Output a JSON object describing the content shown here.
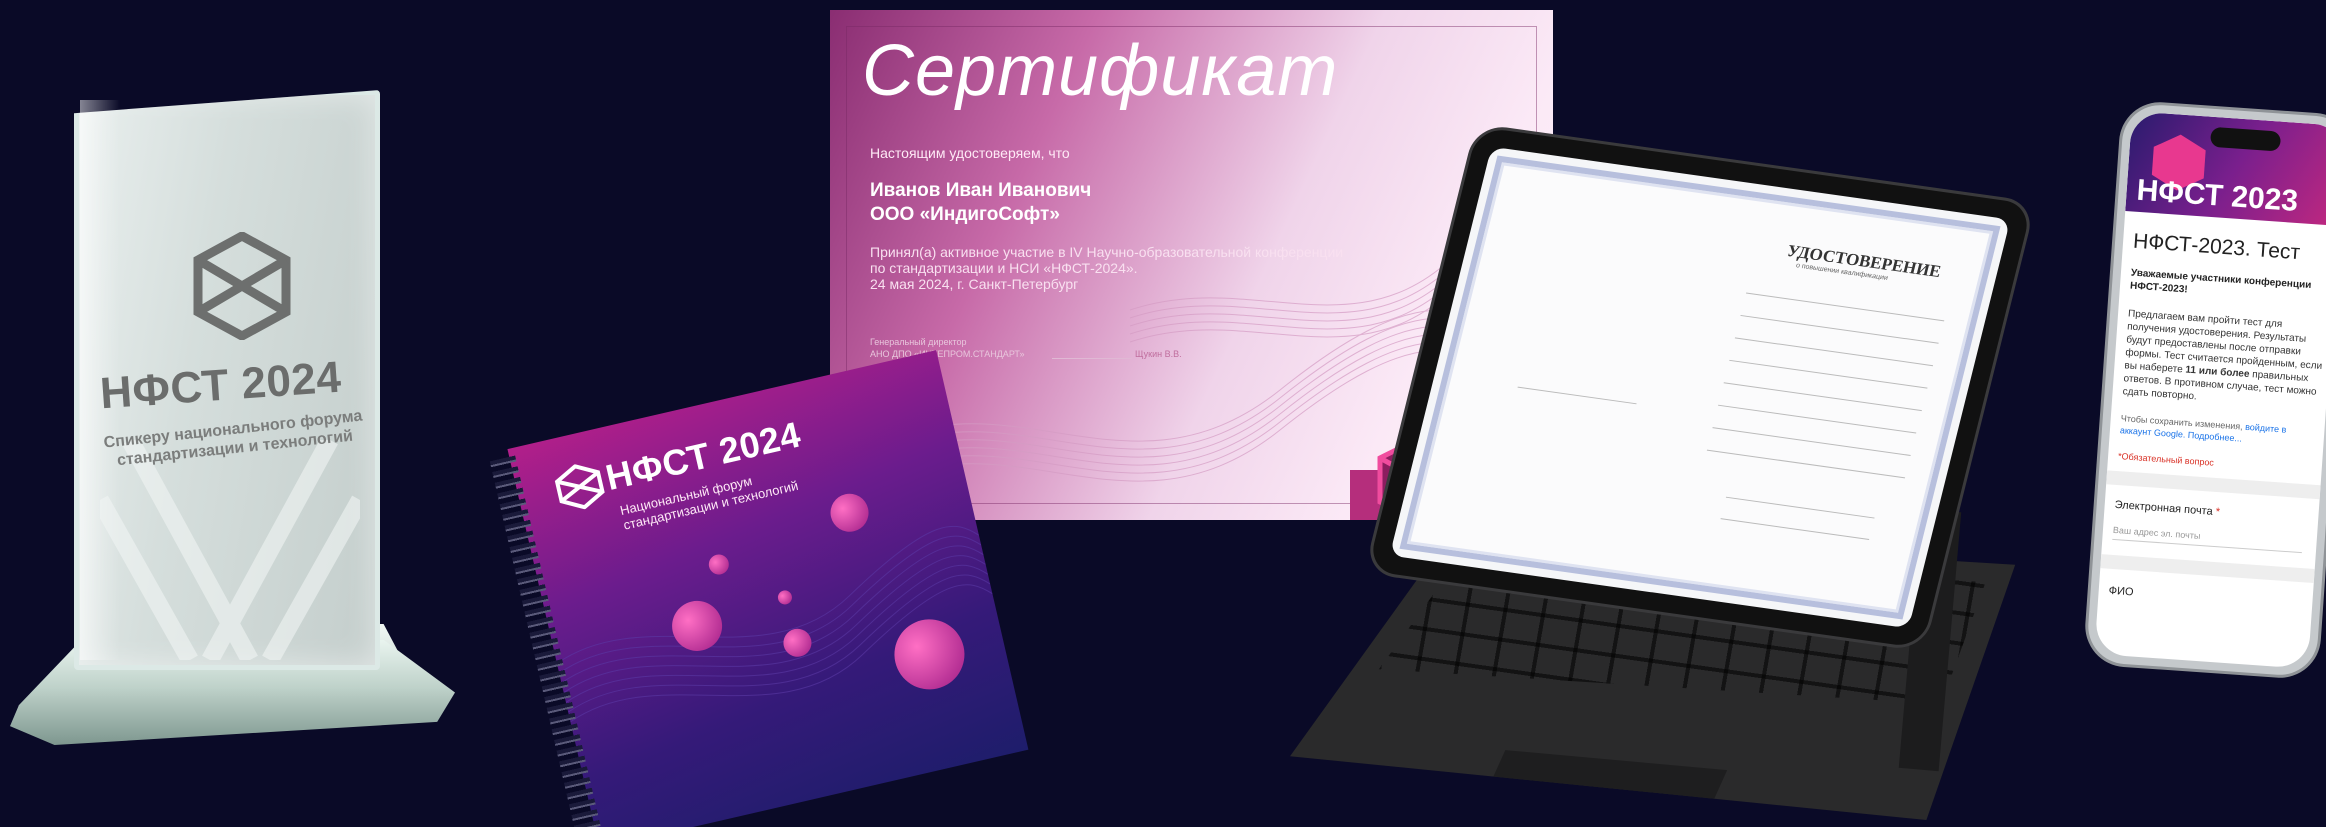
{
  "trophy": {
    "title": "НФСТ 2024",
    "subtitle_line1": "Спикеру национального форума",
    "subtitle_line2": "стандартизации и технологий"
  },
  "certificate": {
    "title": "Сертификат",
    "intro": "Настоящим удостоверяем, что",
    "name": "Иванов Иван Иванович",
    "organization": "ООО «ИндигоСофт»",
    "body_line1": "Принял(а) активное участие в IV Научно-образовательной конференции",
    "body_line2": "по стандартизации и НСИ «НФСТ-2024».",
    "body_line3": "24 мая 2024, г. Санкт-Петербург",
    "signer_role": "Генеральный директор",
    "signer_org": "АНО ДПО «ИНТЕПРОМ.СТАНДАРТ»",
    "signer_name": "Щукин В.В."
  },
  "notebook": {
    "title": "НФСТ 2024",
    "subtitle_line1": "Национальный форум",
    "subtitle_line2": "стандартизации и технологий"
  },
  "tablet": {
    "doc_title": "УДОСТОВЕРЕНИЕ",
    "doc_subtitle": "о повышении квалификации"
  },
  "phone": {
    "banner_title": "НФСТ 2023",
    "form_title": "НФСТ-2023. Тест",
    "greeting": "Уважаемые участники конференции НФСТ-2023!",
    "text_before": "Предлагаем вам пройти тест для получения удостоверения. Результаты будут предоставлены после отправки формы. Тест считается пройденным, если вы наберете ",
    "text_bold": "11 или более",
    "text_after": " правильных ответов. В противном случае, тест можно сдать повторно.",
    "save_text": "Чтобы сохранить изменения, ",
    "save_link": "войдите в аккаунт Google. Подробнее...",
    "required_note": "*Обязательный вопрос",
    "email_label": "Электронная почта",
    "required_star": "*",
    "email_placeholder": "Ваш адрес эл. почты",
    "fio_label": "ФИО"
  },
  "colors": {
    "background": "#0a0a27",
    "accent_pink": "#c2287f",
    "accent_purple": "#6b1c8d"
  }
}
